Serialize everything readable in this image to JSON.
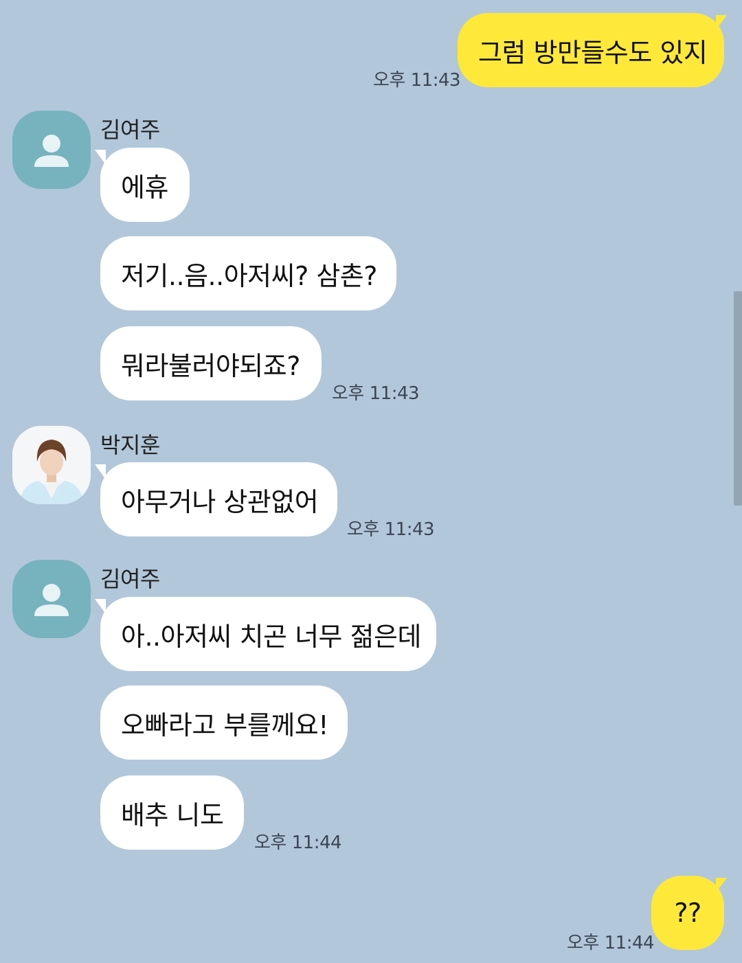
{
  "colors": {
    "background": "#b2c7da",
    "outgoing_bubble": "#fee93b",
    "incoming_bubble": "#ffffff",
    "default_avatar": "#76b3be",
    "timestamp_text": "#3b4652"
  },
  "messages": [
    {
      "direction": "outgoing",
      "text": "그럼 방만들수도 있지",
      "time": "오후 11:43"
    },
    {
      "direction": "incoming",
      "sender": "김여주",
      "avatar": "default-profile-icon",
      "text": "에휴"
    },
    {
      "direction": "incoming",
      "text": "저기..음..아저씨? 삼촌?"
    },
    {
      "direction": "incoming",
      "text": "뭐라불러야되죠?",
      "time": "오후 11:43"
    },
    {
      "direction": "incoming",
      "sender": "박지훈",
      "avatar": "profile-photo",
      "text": "아무거나 상관없어",
      "time": "오후 11:43"
    },
    {
      "direction": "incoming",
      "sender": "김여주",
      "avatar": "default-profile-icon",
      "text": "아..아저씨 치곤 너무 젊은데"
    },
    {
      "direction": "incoming",
      "text": "오빠라고 부를께요!"
    },
    {
      "direction": "incoming",
      "text": "배추 니도",
      "time": "오후 11:44"
    },
    {
      "direction": "outgoing",
      "text": "??",
      "time": "오후 11:44"
    }
  ]
}
